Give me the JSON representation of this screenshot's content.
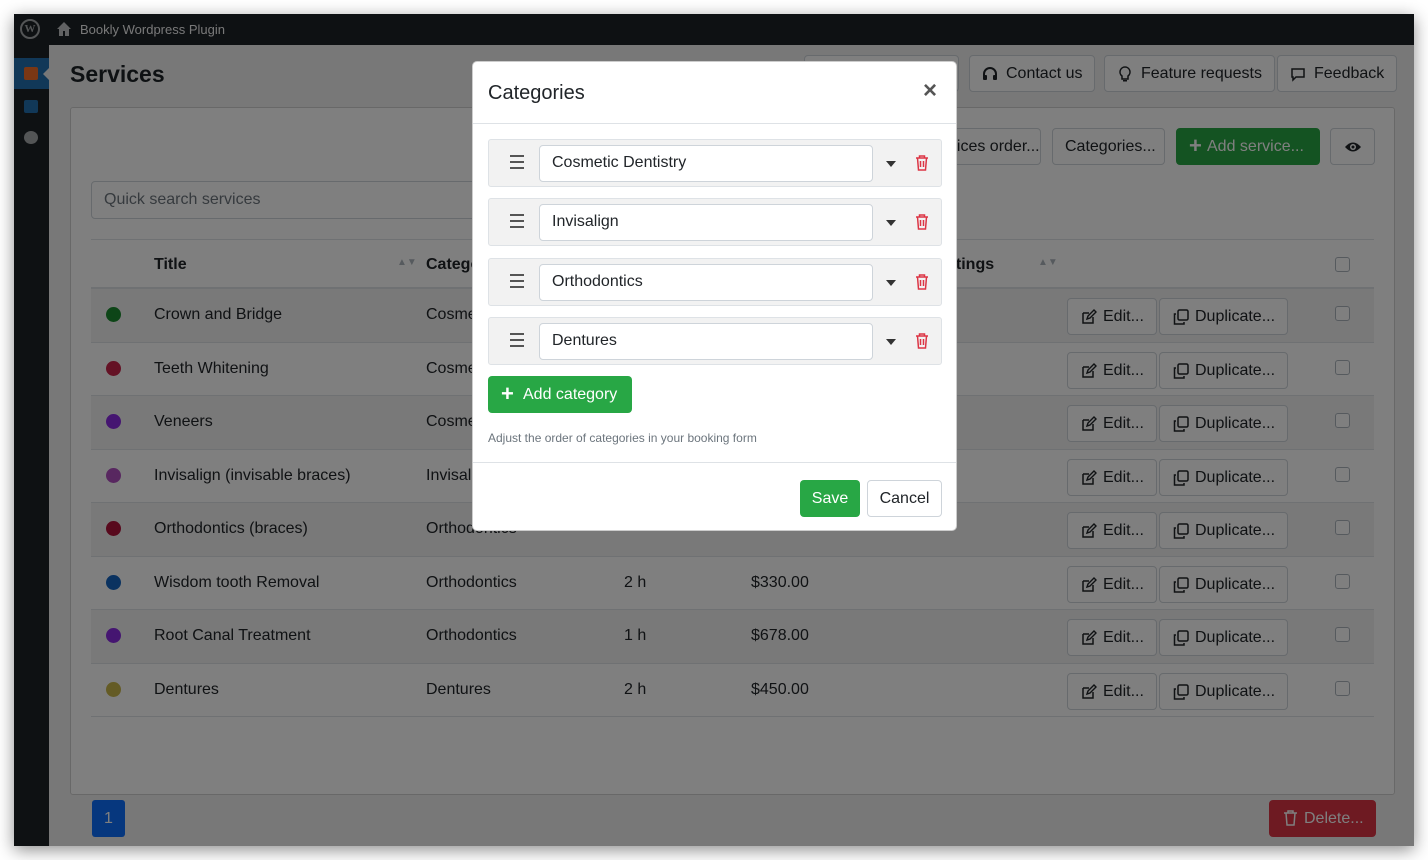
{
  "adminbar": {
    "site_name": "Bookly Wordpress Plugin"
  },
  "page": {
    "title": "Services",
    "top_buttons": {
      "contact": "Contact us",
      "features": "Feature requests",
      "feedback": "Feedback"
    },
    "toolbar": {
      "order": "Services order...",
      "categories": "Categories...",
      "add_service": "Add service..."
    },
    "search_placeholder": "Quick search services",
    "columns": {
      "title": "Title",
      "category": "Category",
      "settings": "Settings"
    },
    "rows": [
      {
        "title": "Crown and Bridge",
        "category": "Cosmetic Dentistry",
        "duration": "",
        "price": "",
        "color": "#1a8a2e"
      },
      {
        "title": "Teeth Whitening",
        "category": "Cosmetic Dentistry",
        "duration": "",
        "price": "",
        "color": "#c8254a"
      },
      {
        "title": "Veneers",
        "category": "Cosmetic Dentistry",
        "duration": "",
        "price": "",
        "color": "#8a2be2"
      },
      {
        "title": "Invisalign (invisable braces)",
        "category": "Invisalign",
        "duration": "",
        "price": "",
        "color": "#b04fc0"
      },
      {
        "title": "Orthodontics (braces)",
        "category": "Orthodontics",
        "duration": "",
        "price": "",
        "color": "#b0123a"
      },
      {
        "title": "Wisdom tooth Removal",
        "category": "Orthodontics",
        "duration": "2 h",
        "price": "$330.00",
        "color": "#1564c0"
      },
      {
        "title": "Root Canal Treatment",
        "category": "Orthodontics",
        "duration": "1 h",
        "price": "$678.00",
        "color": "#8a2be2"
      },
      {
        "title": "Dentures",
        "category": "Dentures",
        "duration": "2 h",
        "price": "$450.00",
        "color": "#c9b74a"
      }
    ],
    "edit_label": "Edit...",
    "duplicate_label": "Duplicate...",
    "pagination": "1",
    "delete_label": "Delete..."
  },
  "modal": {
    "title": "Categories",
    "close": "×",
    "categories": [
      "Cosmetic Dentistry",
      "Invisalign",
      "Orthodontics",
      "Dentures"
    ],
    "add_category": "Add category",
    "hint": "Adjust the order of categories in your booking form",
    "save": "Save",
    "cancel": "Cancel"
  },
  "colors": {
    "accent": "#28a745",
    "danger": "#dc3545",
    "primary": "#0d6efd",
    "adminbar": "#1d2327"
  }
}
